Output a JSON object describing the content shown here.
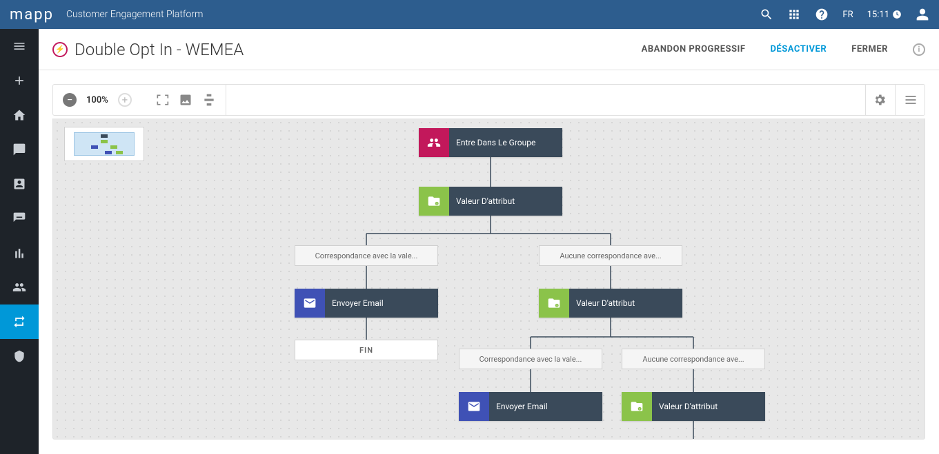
{
  "header": {
    "logo": "mapp",
    "platform": "Customer Engagement Platform",
    "language": "FR",
    "time": "15:11"
  },
  "page": {
    "title": "Double Opt In - WEMEA",
    "actions": {
      "abandon": "ABANDON PROGRESSIF",
      "deactivate": "DÉSACTIVER",
      "close": "FERMER"
    }
  },
  "toolbar": {
    "zoom": "100%"
  },
  "flow": {
    "n1": "Entre Dans Le Groupe",
    "n2": "Valeur D'attribut",
    "t_left": "Correspondance avec la vale...",
    "t_right": "Aucune correspondance ave...",
    "n3": "Envoyer Email",
    "n4": "Valeur D'attribut",
    "end": "FIN",
    "t_left2": "Correspondance avec la vale...",
    "t_right2": "Aucune correspondance ave...",
    "n5": "Envoyer Email",
    "n6": "Valeur D'attribut"
  }
}
